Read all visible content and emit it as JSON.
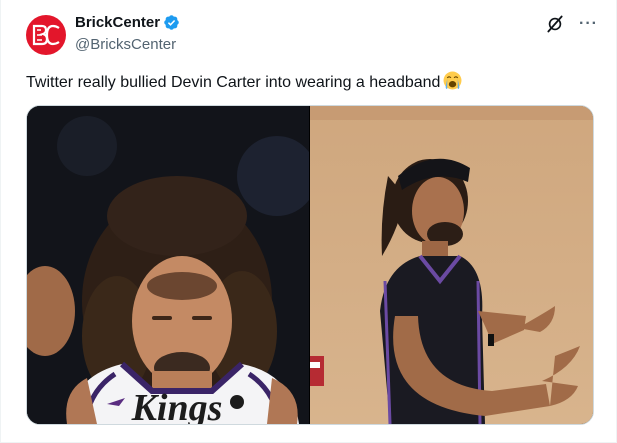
{
  "author": {
    "display_name": "BrickCenter",
    "handle": "@BricksCenter",
    "verified": true,
    "avatar_icon": "brickcenter-logo-avatar",
    "avatar_color": "#e3162b"
  },
  "tweet": {
    "text": "Twitter really bullied Devin Carter into wearing a headband",
    "emoji": "loudly-crying-face-emoji"
  },
  "actions": {
    "grok_icon": "grok-icon",
    "more_icon": "more-options-icon",
    "more_label": "···"
  },
  "media": {
    "photos": [
      {
        "name": "photo-devin-carter-no-headband",
        "jersey_text": "Kings"
      },
      {
        "name": "photo-devin-carter-headband"
      }
    ]
  },
  "colors": {
    "verified_blue": "#1d9bf0",
    "secondary_text": "#536471",
    "kings_purple": "#5a2d81"
  }
}
